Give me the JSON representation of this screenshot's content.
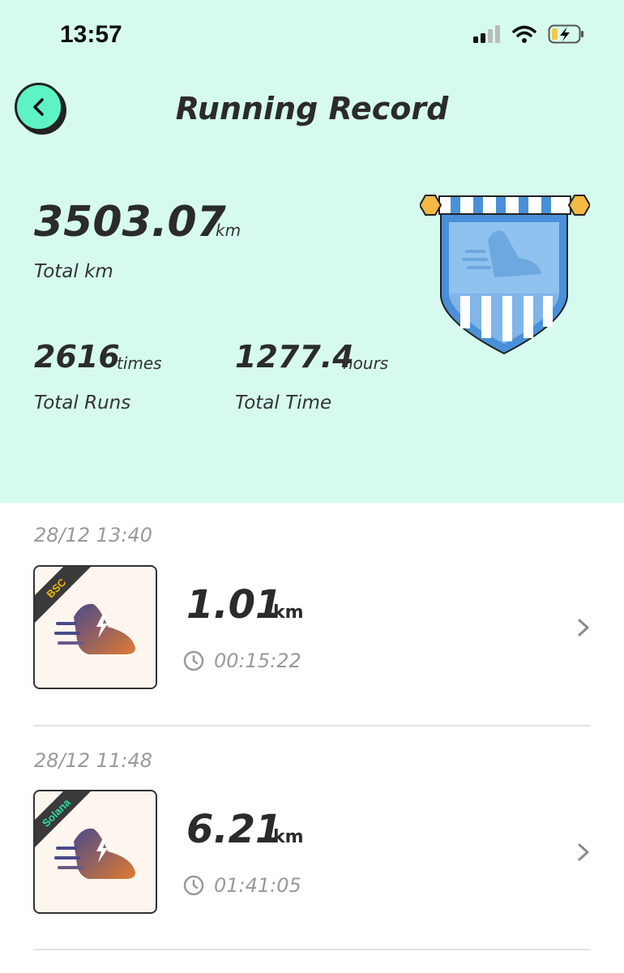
{
  "status_bar": {
    "time": "13:57"
  },
  "header": {
    "title": "Running Record"
  },
  "stats": {
    "total_km": {
      "value": "3503.07",
      "unit": "km",
      "label": "Total km"
    },
    "total_runs": {
      "value": "2616",
      "unit": "times",
      "label": "Total Runs"
    },
    "total_time": {
      "value": "1277.4",
      "unit": "hours",
      "label": "Total Time"
    }
  },
  "runs": [
    {
      "date": "28/12 13:40",
      "chain": "BSC",
      "chain_color": "#f0b90b",
      "distance": "1.01",
      "unit": "km",
      "duration": "00:15:22"
    },
    {
      "date": "28/12 11:48",
      "chain": "Solana",
      "chain_color": "#2fe0a6",
      "distance": "6.21",
      "unit": "km",
      "duration": "01:41:05"
    }
  ],
  "colors": {
    "header_bg": "#d6fbee",
    "accent": "#5ef3c4",
    "banner_blue": "#4a90d9"
  }
}
